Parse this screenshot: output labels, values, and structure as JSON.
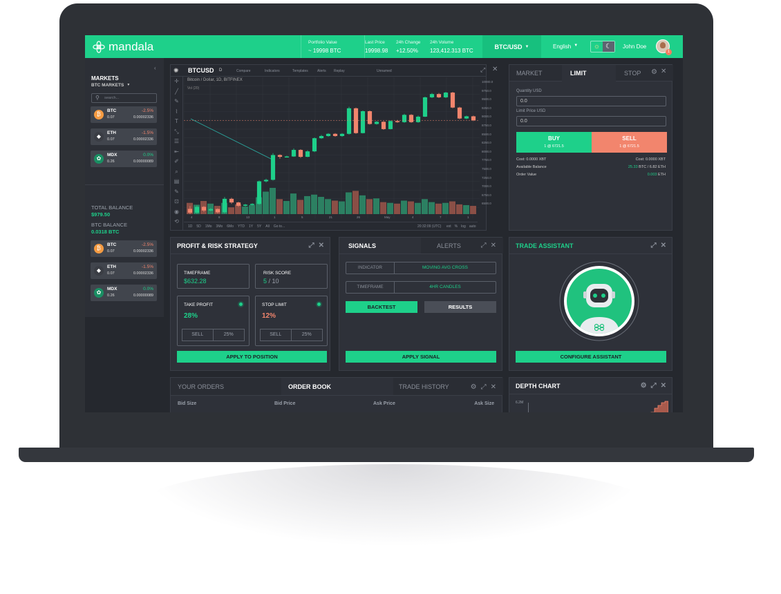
{
  "brand": "mandala",
  "topbar": {
    "portfolio_label": "Portfolio Value",
    "portfolio_value": "~ 19998 BTC",
    "last_price_label": "Last Price",
    "last_price_value": "19998.98",
    "change_label": "24h Change",
    "change_value": "+12.50%",
    "volume_label": "24h Volume",
    "volume_value": "123,412.313 BTC",
    "pair": "BTC/USD",
    "language": "English",
    "user": "John Doe",
    "notif_count": "1"
  },
  "sidebar": {
    "markets_title": "MARKETS",
    "markets_filter": "BTC MARKETS",
    "search_placeholder": "search...",
    "coins": [
      {
        "name": "BTC",
        "price": "0.07",
        "change": "-2.5%",
        "vol": "0.00002336",
        "dir": "down"
      },
      {
        "name": "ETH",
        "price": "0.07",
        "change": "-1.5%",
        "vol": "0.00002336",
        "dir": "down"
      },
      {
        "name": "MDX",
        "price": "0.26",
        "change": "0.0%",
        "vol": "0.00000089",
        "dir": "up"
      }
    ],
    "total_balance_label": "TOTAL BALANCE",
    "total_balance": "$979.50",
    "btc_balance_label": "BTC BALANCE",
    "btc_balance": "0.0318 BTC",
    "coins2": [
      {
        "name": "BTC",
        "price": "0.07",
        "change": "-2.5%",
        "vol": "0.00002336",
        "dir": "down"
      },
      {
        "name": "ETH",
        "price": "0.07",
        "change": "-1.5%",
        "vol": "0.00002336",
        "dir": "down"
      },
      {
        "name": "MDX",
        "price": "0.26",
        "change": "0.0%",
        "vol": "0.00000089",
        "dir": "up"
      }
    ]
  },
  "chart_panel": {
    "symbol": "BTCUSD",
    "interval": "D",
    "compare": "Compare",
    "indicators": "Indicators",
    "templates": "Templates",
    "alerts": "Alerts",
    "replay": "Replay",
    "layout": "Unnamed",
    "legend": "Bitcoin / Dollar, 1D, BITFINEX",
    "vol_label": "Vol (20)",
    "price_ticks": [
      "10000.0",
      "9750.0",
      "9500.0",
      "9250.0",
      "9000.0",
      "8750.0",
      "8500.0",
      "8250.0",
      "8000.0",
      "7750.0",
      "7500.0",
      "7250.0",
      "7000.0",
      "6750.0",
      "6500.0"
    ],
    "date_ticks": [
      "4",
      "8",
      "13",
      "1",
      "5",
      "21",
      "26",
      "May",
      "4",
      "7",
      "1"
    ],
    "ranges": [
      "1D",
      "5D",
      "1Mo",
      "3Mo",
      "6Mo",
      "YTD",
      "1Y",
      "5Y",
      "All",
      "Go to..."
    ],
    "time": "20:32:09 (UTC)",
    "scale_opts": [
      "ext",
      "%",
      "log",
      "auto"
    ]
  },
  "chart_data": {
    "type": "candlestick",
    "candles": [
      [
        6625,
        6520,
        6700,
        6480
      ],
      [
        6520,
        6680,
        6720,
        6490
      ],
      [
        6680,
        6580,
        6700,
        6540
      ],
      [
        6580,
        6620,
        6650,
        6560
      ],
      [
        6620,
        6530,
        6640,
        6500
      ],
      [
        6530,
        6900,
        6950,
        6500
      ],
      [
        6900,
        6800,
        6930,
        6760
      ],
      [
        6800,
        6710,
        6820,
        6680
      ],
      [
        6710,
        6740,
        6760,
        6690
      ],
      [
        6740,
        6760,
        6780,
        6720
      ],
      [
        6760,
        7380,
        7400,
        6740
      ],
      [
        7380,
        7420,
        7450,
        7350
      ],
      [
        7420,
        8100,
        8150,
        7400
      ],
      [
        8100,
        8050,
        8120,
        8000
      ],
      [
        8050,
        8060,
        8080,
        8030
      ],
      [
        8060,
        8240,
        8280,
        8050
      ],
      [
        8240,
        8050,
        8260,
        8020
      ],
      [
        8050,
        8200,
        8230,
        8040
      ],
      [
        8200,
        8560,
        8580,
        8180
      ],
      [
        8560,
        8620,
        8650,
        8540
      ],
      [
        8620,
        8680,
        8700,
        8600
      ],
      [
        8680,
        8620,
        8700,
        8600
      ],
      [
        8620,
        8680,
        8700,
        8600
      ],
      [
        8680,
        9380,
        9420,
        8660
      ],
      [
        9380,
        8700,
        9400,
        8680
      ],
      [
        8700,
        9300,
        9320,
        8690
      ],
      [
        9300,
        8950,
        9320,
        8930
      ],
      [
        8950,
        9010,
        9030,
        8930
      ],
      [
        9010,
        8810,
        9030,
        8790
      ],
      [
        8810,
        9030,
        9050,
        8800
      ],
      [
        9030,
        9000,
        9060,
        8980
      ],
      [
        9000,
        9200,
        9230,
        8980
      ],
      [
        9200,
        9000,
        9220,
        8980
      ],
      [
        9000,
        9150,
        9180,
        8980
      ],
      [
        9150,
        9680,
        9700,
        9140
      ],
      [
        9680,
        9770,
        9800,
        9660
      ],
      [
        9770,
        9680,
        9800,
        9660
      ],
      [
        9680,
        9810,
        9830,
        9660
      ],
      [
        9810,
        9400,
        9830,
        9380
      ],
      [
        9400,
        9100,
        9420,
        9080
      ],
      [
        9100,
        9160,
        9180,
        9080
      ],
      [
        9160,
        9050,
        9180,
        9030
      ]
    ],
    "volumes": [
      30,
      25,
      35,
      28,
      22,
      30,
      18,
      26,
      20,
      24,
      45,
      60,
      70,
      40,
      35,
      55,
      38,
      48,
      52,
      46,
      40,
      36,
      34,
      58,
      62,
      50,
      40,
      42,
      32,
      30,
      28,
      36,
      34,
      30,
      40,
      32,
      28,
      30,
      34,
      26,
      24,
      22
    ],
    "ylim": [
      6500,
      10000
    ]
  },
  "order_panel": {
    "tabs": [
      "MARKET",
      "LIMIT",
      "STOP"
    ],
    "qty_label": "Quantity USD",
    "qty_value": "0.0",
    "limit_label": "Limit Price USD",
    "limit_value": "0.0",
    "buy": "BUY",
    "buy_sub": "1 @ 6721.5",
    "sell": "SELL",
    "sell_sub": "1 @ 6721.5",
    "cost_buy": "Cost: 0.0000 XBT",
    "cost_sell": "Cost: 0.0000 XBT",
    "avail_label": "Available Balance",
    "avail_a": "25.33",
    "avail_b": "BTC / 6.82 ETH",
    "order_value_label": "Order Value",
    "order_value": "0.003",
    "order_value_unit": "ETH"
  },
  "risk": {
    "title": "PROFIT & RISK STRATEGY",
    "timeframe_label": "TIMEFRAME",
    "timeframe_value": "$632.28",
    "risk_label": "RISK SCORE",
    "risk_value": "5",
    "risk_of": "/ 10",
    "tp_label": "TAKE PROFIT",
    "tp_value": "28%",
    "sl_label": "STOP LIMIT",
    "sl_value": "12%",
    "sell": "SELL",
    "pct": "25%",
    "apply": "APPLY TO POSITION"
  },
  "signals": {
    "tab1": "SIGNALS",
    "tab2": "ALERTS",
    "ind_label": "INDICATOR",
    "ind_value": "MOVING AVG CROSS",
    "tf_label": "TIMEFRAME",
    "tf_value": "4HR CANDLES",
    "backtest": "BACKTEST",
    "results": "RESULTS",
    "apply": "APPLY SIGNAL"
  },
  "assistant": {
    "title": "TRADE ASSISTANT",
    "configure": "CONFIGURE ASSISTANT"
  },
  "orders": {
    "tabs": [
      "YOUR ORDERS",
      "ORDER BOOK",
      "TRADE HISTORY"
    ],
    "cols": [
      "Bid Size",
      "Bid Price",
      "Ask Price",
      "Ask Size"
    ]
  },
  "depth": {
    "title": "DEPTH CHART",
    "ytick": "6.2M"
  }
}
